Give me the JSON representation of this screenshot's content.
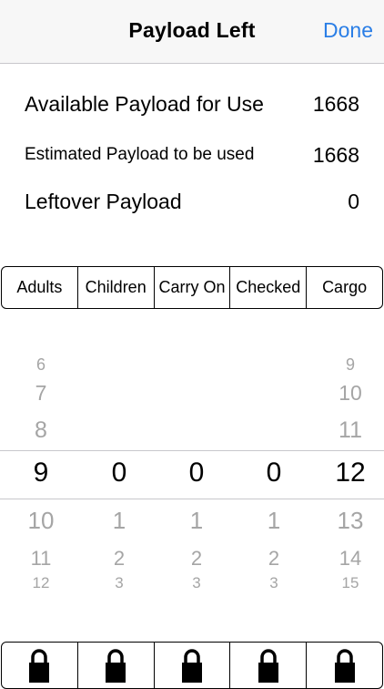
{
  "nav": {
    "title": "Payload Left",
    "done": "Done"
  },
  "summary": {
    "available_label": "Available Payload for Use",
    "available_value": "1668",
    "estimated_label": "Estimated Payload to be used",
    "estimated_value": "1668",
    "leftover_label": "Leftover Payload",
    "leftover_value": "0"
  },
  "segments": [
    "Adults",
    "Children",
    "Carry On",
    "Checked",
    "Cargo"
  ],
  "picker": {
    "adults": {
      "faded_above": [
        "6",
        "7",
        "8"
      ],
      "selected": "9",
      "faded_below": [
        "10",
        "11",
        "12"
      ]
    },
    "children": {
      "faded_above": [],
      "selected": "0",
      "faded_below": [
        "1",
        "2",
        "3"
      ]
    },
    "carry_on": {
      "faded_above": [],
      "selected": "0",
      "faded_below": [
        "1",
        "2",
        "3"
      ]
    },
    "checked": {
      "faded_above": [],
      "selected": "0",
      "faded_below": [
        "1",
        "2",
        "3"
      ]
    },
    "cargo": {
      "faded_above": [
        "9",
        "10",
        "11"
      ],
      "selected": "12",
      "faded_below": [
        "13",
        "14",
        "15"
      ]
    }
  },
  "locks": [
    "lock-icon",
    "lock-icon",
    "lock-icon",
    "lock-icon",
    "lock-icon"
  ],
  "colors": {
    "accent": "#2a7ee6",
    "faded": "#a5a5a5"
  }
}
